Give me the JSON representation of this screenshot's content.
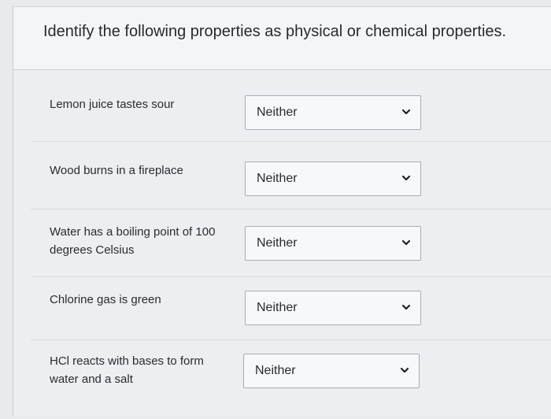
{
  "question": {
    "instruction": "Identify the following properties as physical or chemical properties."
  },
  "rows": [
    {
      "prompt": "Lemon juice tastes sour",
      "selected": "Neither"
    },
    {
      "prompt": "Wood burns in a fireplace",
      "selected": "Neither"
    },
    {
      "prompt": "Water has a boiling point of 100 degrees Celsius",
      "selected": "Neither"
    },
    {
      "prompt": "Chlorine gas is green",
      "selected": "Neither"
    },
    {
      "prompt": "HCl reacts with bases to form water and a salt",
      "selected": "Neither"
    }
  ],
  "icons": {
    "dropdown": "chevron-down-icon"
  },
  "colors": {
    "chevron": "#1f1f24",
    "select_border": "#a9adb3",
    "text": "#2a2a2e"
  }
}
